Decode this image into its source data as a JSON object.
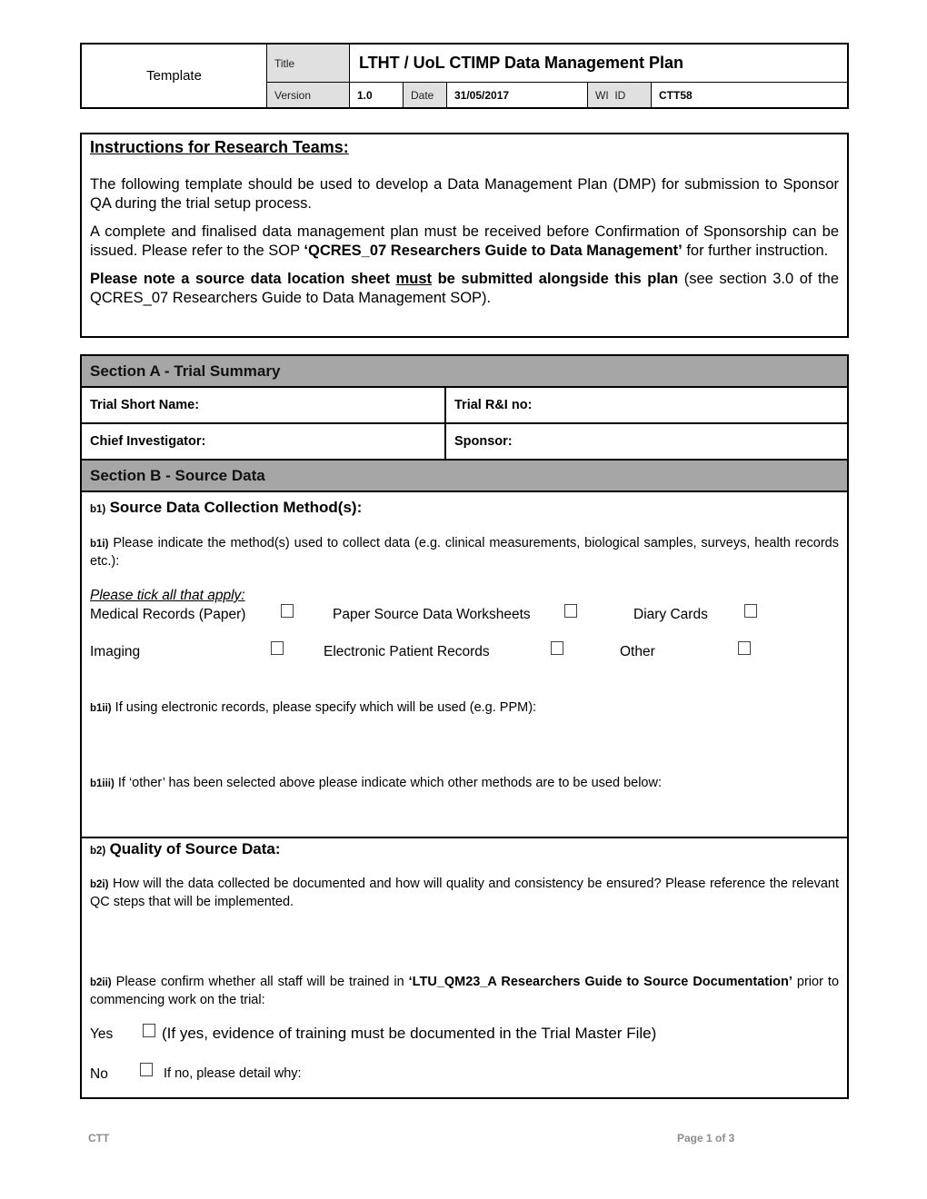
{
  "header": {
    "template_label": "Template",
    "title_label": "Title",
    "title": "LTHT / UoL CTIMP Data Management Plan",
    "version_label": "Version",
    "version": "1.0",
    "date_label": "Date",
    "date": "31/05/2017",
    "wi_id_label": "WI  ID",
    "wi_id": "CTT58"
  },
  "instructions": {
    "heading": "Instructions for Research Teams:",
    "p1": "The following template should be used to develop a Data Management Plan (DMP) for submission to Sponsor QA during the trial setup process.",
    "p2_a": "A complete and finalised data management plan must be received before Confirmation of Sponsorship can be issued. Please refer to the SOP ",
    "p2_b": "‘QCRES_07 Researchers Guide to Data Management’",
    "p2_c": " for further instruction.",
    "p3_a": "Please note a source data location sheet ",
    "p3_b": "must",
    "p3_c": " be submitted alongside this plan",
    "p3_d": " (see section 3.0 of the QCRES_07 Researchers Guide to Data Management SOP)."
  },
  "section_a": {
    "heading": "Section A - Trial Summary",
    "fields": [
      {
        "label": "Trial Short Name:",
        "value": ""
      },
      {
        "label": "Trial R&I no:",
        "value": ""
      },
      {
        "label": "Chief Investigator:",
        "value": ""
      },
      {
        "label": "Sponsor:",
        "value": ""
      }
    ]
  },
  "section_b": {
    "heading": "Section B - Source Data",
    "b1": {
      "num": "b1)",
      "title": "Source Data Collection Method(s):",
      "b1i_num": "b1i)",
      "b1i_text": "Please indicate the method(s) used to collect data (e.g. clinical measurements, biological samples, surveys, health records etc.):",
      "tick_hint": "Please tick all that apply:",
      "options": [
        {
          "label": "Medical Records (Paper)",
          "checked": false
        },
        {
          "label": "Paper Source Data Worksheets",
          "checked": false
        },
        {
          "label": "Diary Cards",
          "checked": false
        },
        {
          "label": "Imaging",
          "checked": false
        },
        {
          "label": "Electronic Patient Records",
          "checked": false
        },
        {
          "label": "Other",
          "checked": false
        }
      ],
      "b1ii_num": "b1ii)",
      "b1ii_text": "If using electronic records, please specify which will be used (e.g. PPM):",
      "b1iii_num": "b1iii)",
      "b1iii_text": "If ‘other’ has been selected above please indicate which other methods are to be used below:"
    },
    "b2": {
      "num": "b2)",
      "title": "Quality of Source Data:",
      "b2i_num": "b2i)",
      "b2i_text": "How will the data collected be documented and how will quality and consistency be ensured? Please reference the relevant QC steps that will be implemented.",
      "b2ii_num": "b2ii)",
      "b2ii_a": "Please confirm whether all staff will be trained in ",
      "b2ii_b": "‘LTU_QM23_A Researchers Guide to Source Documentation’",
      "b2ii_c": " prior to commencing work on the trial:",
      "yes_label": "Yes",
      "yes_text": "(If yes, evidence of training must be documented in the Trial Master File)",
      "yes_checked": false,
      "no_label": "No",
      "no_text": "If no, please detail why:",
      "no_checked": false
    }
  },
  "footer": {
    "left": "CTT",
    "right": "Page 1 of 3"
  }
}
